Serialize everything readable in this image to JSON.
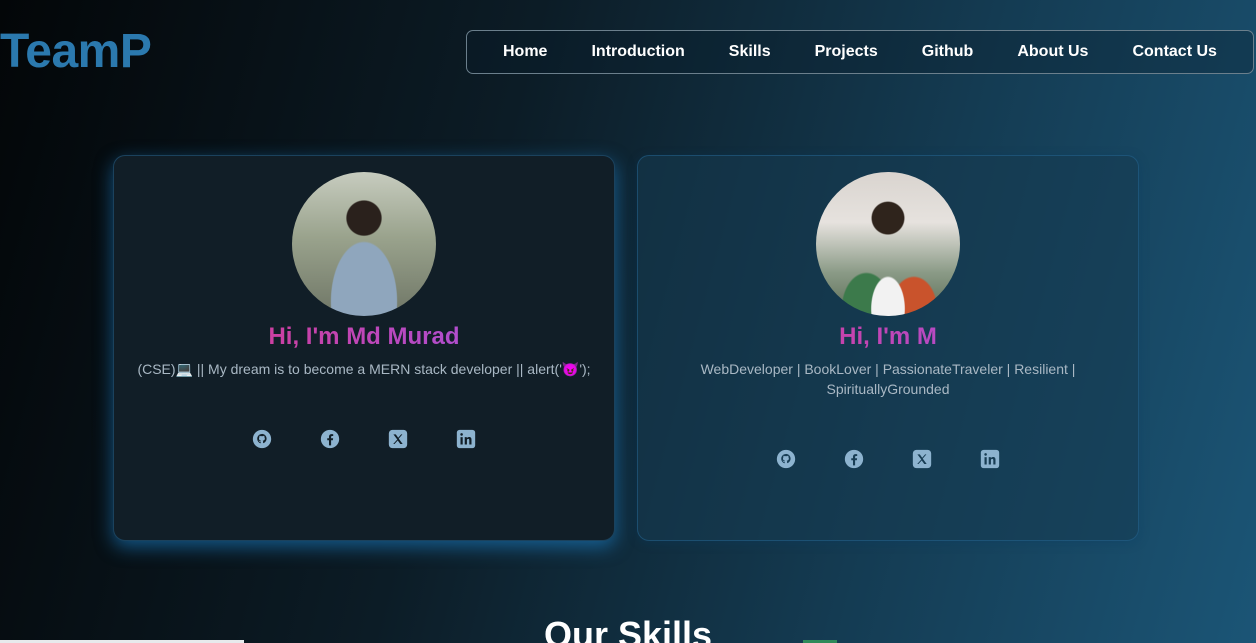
{
  "brand": {
    "logo": "TeamP"
  },
  "nav": {
    "items": [
      "Home",
      "Introduction",
      "Skills",
      "Projects",
      "Github",
      "About Us",
      "Contact Us"
    ]
  },
  "profiles": [
    {
      "greeting": "Hi, I'm Md Murad",
      "bio": "(CSE)💻 || My dream is to become a MERN stack developer || alert('😈');",
      "socials": [
        "github-icon",
        "facebook-icon",
        "x-icon",
        "linkedin-icon"
      ]
    },
    {
      "greeting": "Hi, I'm M",
      "bio": "WebDeveloper | BookLover | PassionateTraveler | Resilient | SpirituallyGrounded",
      "socials": [
        "github-icon",
        "facebook-icon",
        "x-icon",
        "linkedin-icon"
      ]
    }
  ],
  "skills": {
    "title": "Our Skills"
  },
  "colors": {
    "logo": "#2b79ae",
    "greeting_start": "#e2347f",
    "greeting_end": "#9b59f0",
    "icon": "#8db3cf"
  }
}
